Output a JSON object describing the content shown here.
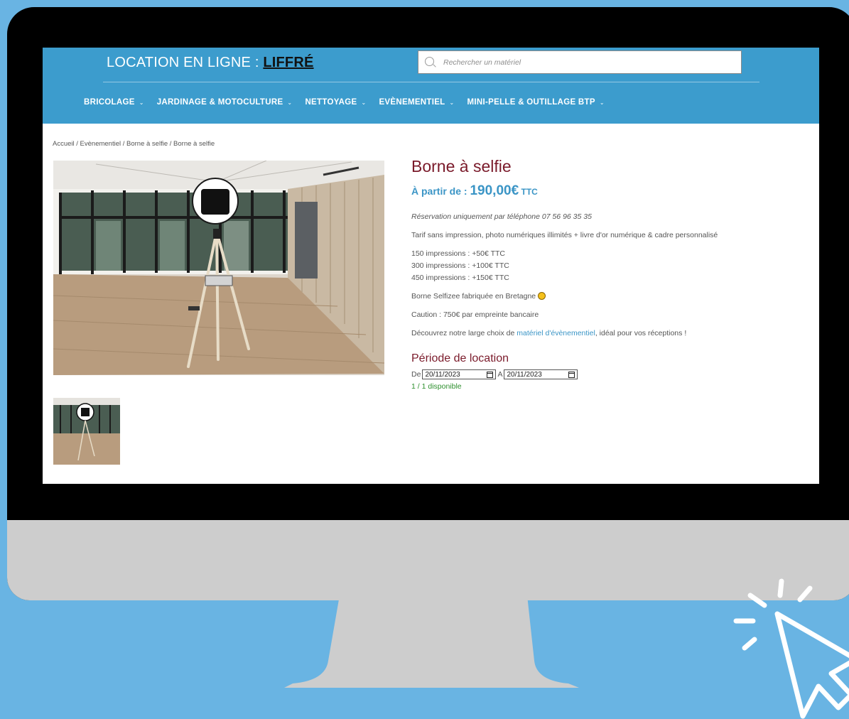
{
  "header": {
    "site_title_prefix": "LOCATION EN LIGNE : ",
    "site_title_city": "LIFFRÉ",
    "search_placeholder": "Rechercher un matériel"
  },
  "nav": {
    "items": [
      {
        "label": "BRICOLAGE"
      },
      {
        "label": "JARDINAGE & MOTOCULTURE"
      },
      {
        "label": "NETTOYAGE"
      },
      {
        "label": "EVÈNEMENTIEL"
      },
      {
        "label": "MINI-PELLE & OUTILLAGE BTP"
      }
    ]
  },
  "breadcrumb": "Accueil / Evènementiel / Borne à selfie / Borne à selfie",
  "product": {
    "title": "Borne à selfie",
    "price_prefix": "À partir de : ",
    "price": "190,00€",
    "price_suffix": " TTC",
    "reservation_note": "Réservation uniquement par téléphone 07 56 96 35 35",
    "description": "Tarif sans impression, photo numériques illimités + livre d'or numérique & cadre personnalisé",
    "options": [
      "150 impressions : +50€ TTC",
      "300 impressions : +100€ TTC",
      "450 impressions : +150€ TTC"
    ],
    "origin": "Borne Selfizee fabriquée en Bretagne ",
    "caution_label": "Caution",
    "caution_text": " : 750€ par empreinte bancaire",
    "discover_prefix": "Découvrez notre large choix de ",
    "discover_link": "matériel d'évènementiel",
    "discover_suffix": ", idéal pour vos réceptions !"
  },
  "rental": {
    "title": "Période de location",
    "from_label": "De",
    "from_date": "20/11/2023",
    "to_label": "A",
    "to_date": "20/11/2023",
    "availability": "1 / 1 disponible"
  }
}
